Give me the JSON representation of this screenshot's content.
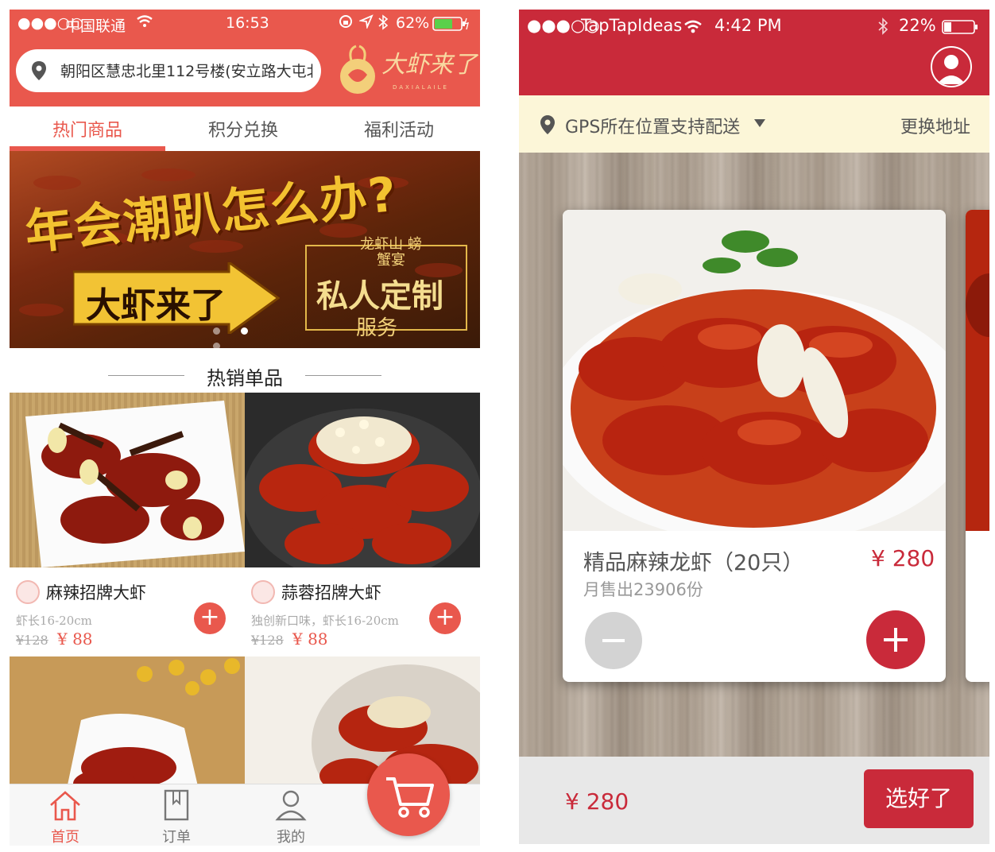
{
  "left": {
    "status": {
      "signal": "●●●○○",
      "carrier": "中国联通",
      "time": "16:53",
      "battery": "62%"
    },
    "address": "朝阳区慧忠北里112号楼(安立路大屯北",
    "logo": {
      "text": "大虾来了",
      "sub": "DAXIALAILE"
    },
    "tabs": [
      {
        "label": "热门商品"
      },
      {
        "label": "积分兑换"
      },
      {
        "label": "福利活动"
      }
    ],
    "banner": {
      "line1": "年会潮趴怎么办?",
      "line2": "大虾来了",
      "seal_a": "龙虾山 螃蟹宴",
      "seal_b": "私人定制",
      "seal_c": "服务"
    },
    "section_title": "热销单品",
    "products": [
      {
        "name": "麻辣招牌大虾",
        "desc": "虾长16-20cm",
        "old_price": "¥128",
        "price": "¥ 88"
      },
      {
        "name": "蒜蓉招牌大虾",
        "desc": "独创新口味，虾长16-20cm",
        "old_price": "¥128",
        "price": "¥ 88"
      }
    ],
    "tabbar": [
      {
        "label": "首页"
      },
      {
        "label": "订单"
      },
      {
        "label": "我的"
      }
    ]
  },
  "right": {
    "status": {
      "signal": "●●●○○",
      "carrier": "TapTapIdeas",
      "time": "4:42 PM",
      "battery": "22%"
    },
    "location": {
      "text": "GPS所在位置支持配送",
      "change": "更换地址"
    },
    "card": {
      "name": "精品麻辣龙虾（20只）",
      "sold": "月售出23906份",
      "price": "¥ 280"
    },
    "total": "¥ 280",
    "done_label": "选好了"
  },
  "colors": {
    "left_accent": "#e9584d",
    "right_accent": "#c92a3a",
    "location_bg": "#fcf6d8"
  }
}
